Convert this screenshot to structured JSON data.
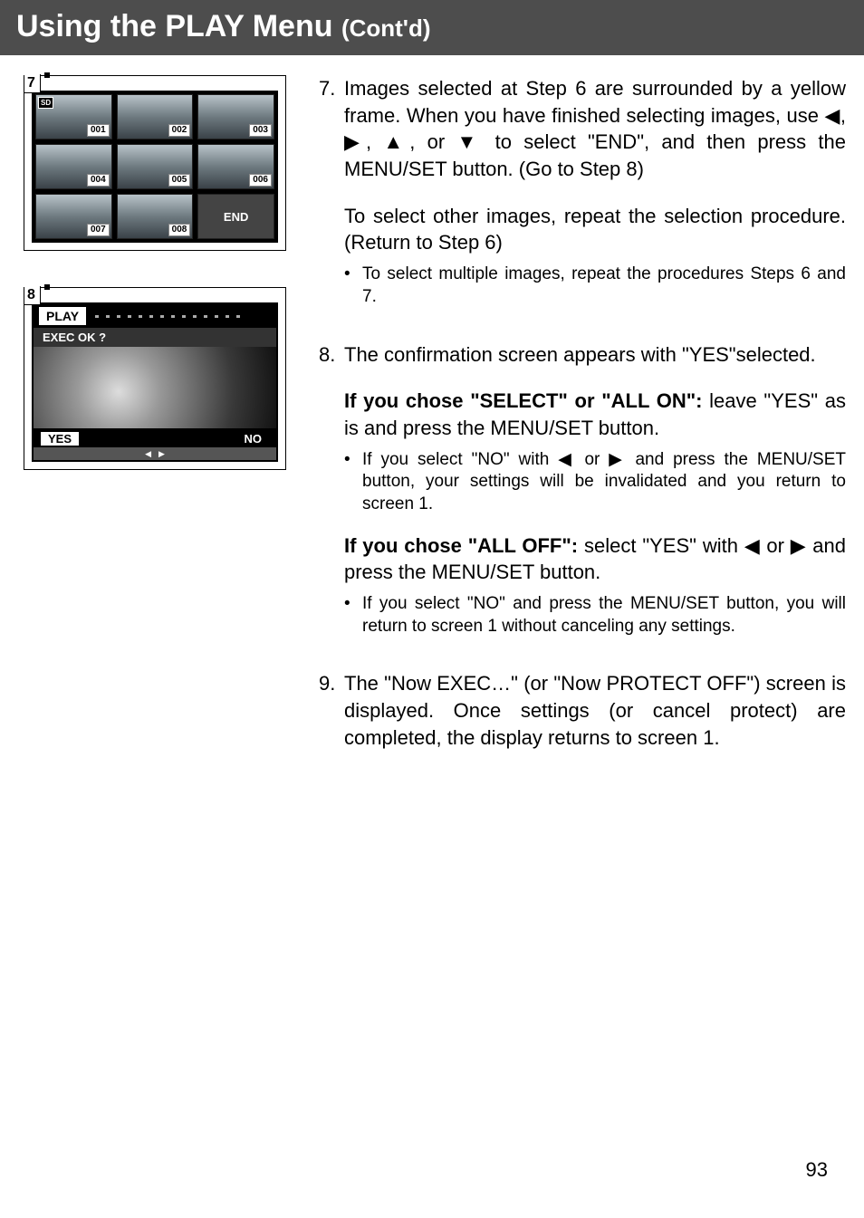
{
  "header": {
    "main": "Using the PLAY Menu ",
    "sub": "(Cont'd)"
  },
  "fig7": {
    "label": "7",
    "sd": "SD",
    "thumbs": [
      "001",
      "002",
      "003",
      "004",
      "005",
      "006",
      "007",
      "008"
    ],
    "end": "END"
  },
  "fig8": {
    "label": "8",
    "play": "PLAY",
    "exec": "EXEC OK ?",
    "yes": "YES",
    "no": "NO",
    "nav_left": "◀",
    "nav_right": "▶"
  },
  "steps": {
    "s7": {
      "num": "7.",
      "p1a": "Images selected at Step 6 are surrounded by a yellow frame. When you have finished selecting images, use ",
      "arrows": "◀, ▶, ▲, or ▼",
      "p1b": " to select \"END\", and then press the MENU/SET button. (Go to Step 8)",
      "p2": "To select other images, repeat the selection procedure. (Return to Step 6)",
      "b1": "To select multiple images, repeat the procedures Steps 6 and 7."
    },
    "s8": {
      "num": "8.",
      "p1": "The confirmation screen appears with \"YES\"selected.",
      "p2bold": "If you chose \"SELECT\" or \"ALL ON\":",
      "p2rest": " leave \"YES\" as is and press the MENU/SET button.",
      "b1a": "If you select \"NO\" with ",
      "b1arrows": "◀ or ▶",
      "b1b": " and press the MENU/SET button, your settings will be invalidated and you return to screen 1.",
      "p3bold": "If you chose \"ALL OFF\":",
      "p3rest": " select \"YES\" with ",
      "p3arrows": "◀ or ▶",
      "p3end": " and press the MENU/SET button.",
      "b2": "If you select \"NO\" and press the MENU/SET button, you will return to screen 1 without canceling any settings."
    },
    "s9": {
      "num": "9.",
      "p1": "The \"Now EXEC…\" (or \"Now PROTECT OFF\") screen is displayed.  Once settings (or cancel protect) are completed, the display returns to screen 1."
    }
  },
  "page": "93"
}
